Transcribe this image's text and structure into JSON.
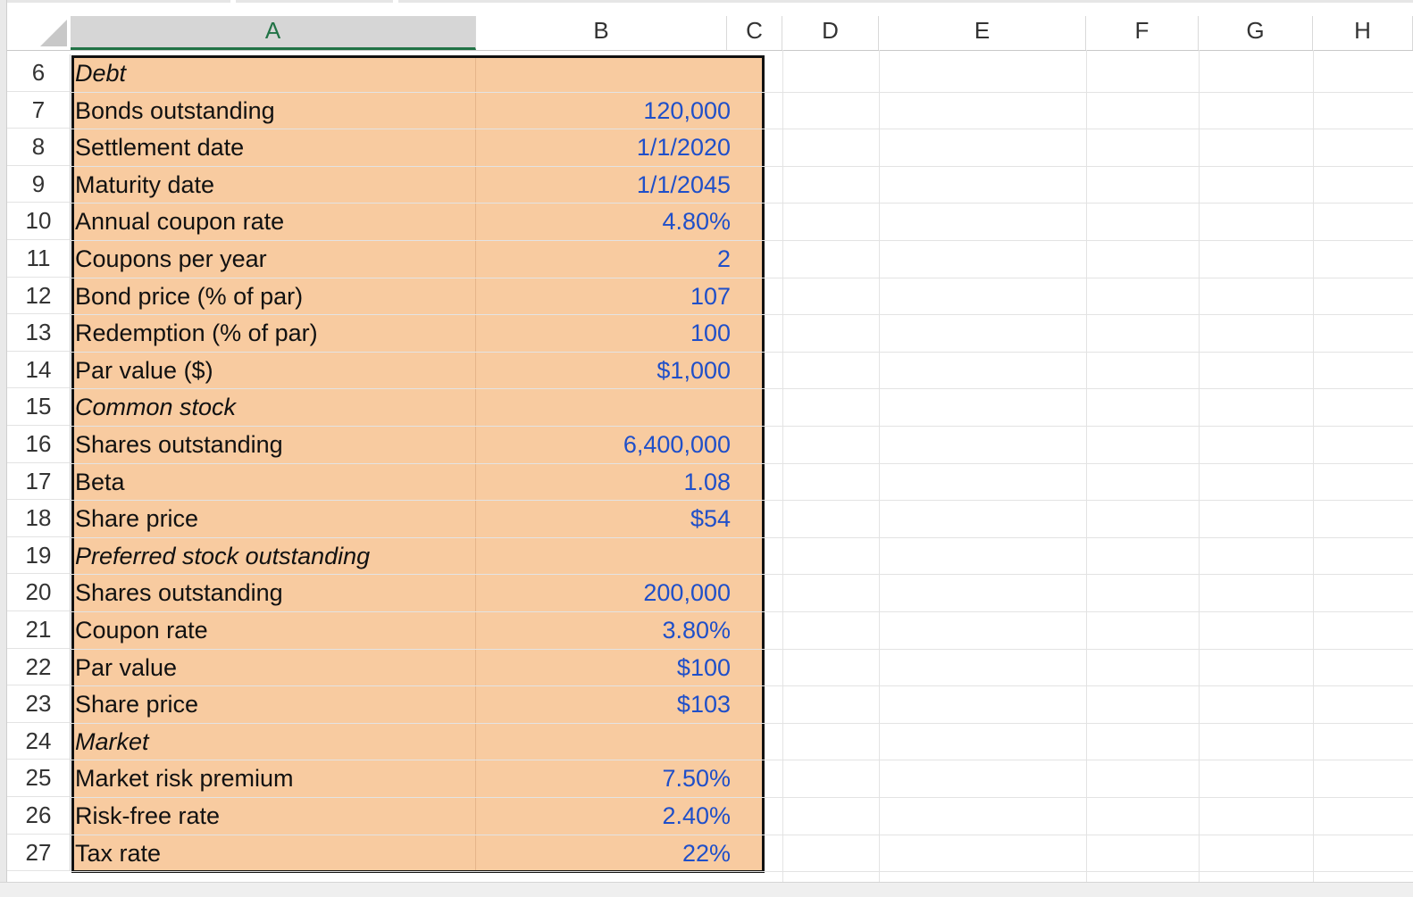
{
  "columns": [
    {
      "label": "A",
      "selected": true
    },
    {
      "label": "B",
      "selected": false
    },
    {
      "label": "C",
      "selected": false
    },
    {
      "label": "D",
      "selected": false
    },
    {
      "label": "E",
      "selected": false
    },
    {
      "label": "F",
      "selected": false
    },
    {
      "label": "G",
      "selected": false
    },
    {
      "label": "H",
      "selected": false
    }
  ],
  "rows": [
    {
      "num": "6",
      "label": "Debt",
      "value": "",
      "italic": true
    },
    {
      "num": "7",
      "label": "Bonds outstanding",
      "value": "120,000",
      "italic": false
    },
    {
      "num": "8",
      "label": "Settlement date",
      "value": "1/1/2020",
      "italic": false
    },
    {
      "num": "9",
      "label": "Maturity date",
      "value": "1/1/2045",
      "italic": false
    },
    {
      "num": "10",
      "label": "Annual coupon rate",
      "value": "4.80%",
      "italic": false
    },
    {
      "num": "11",
      "label": "Coupons per year",
      "value": "2",
      "italic": false
    },
    {
      "num": "12",
      "label": "Bond price (% of par)",
      "value": "107",
      "italic": false
    },
    {
      "num": "13",
      "label": "Redemption (% of par)",
      "value": "100",
      "italic": false
    },
    {
      "num": "14",
      "label": "Par value ($)",
      "value": "$1,000",
      "italic": false
    },
    {
      "num": "15",
      "label": "Common stock",
      "value": "",
      "italic": true
    },
    {
      "num": "16",
      "label": "Shares outstanding",
      "value": "6,400,000",
      "italic": false
    },
    {
      "num": "17",
      "label": "Beta",
      "value": "1.08",
      "italic": false
    },
    {
      "num": "18",
      "label": "Share price",
      "value": "$54",
      "italic": false
    },
    {
      "num": "19",
      "label": "Preferred stock outstanding",
      "value": "",
      "italic": true
    },
    {
      "num": "20",
      "label": "Shares outstanding",
      "value": "200,000",
      "italic": false
    },
    {
      "num": "21",
      "label": "Coupon rate",
      "value": "3.80%",
      "italic": false
    },
    {
      "num": "22",
      "label": "Par value",
      "value": "$100",
      "italic": false
    },
    {
      "num": "23",
      "label": "Share price",
      "value": "$103",
      "italic": false
    },
    {
      "num": "24",
      "label": "Market",
      "value": "",
      "italic": true
    },
    {
      "num": "25",
      "label": "Market risk premium",
      "value": "7.50%",
      "italic": false
    },
    {
      "num": "26",
      "label": "Risk-free rate",
      "value": "2.40%",
      "italic": false
    },
    {
      "num": "27",
      "label": "Tax rate",
      "value": "22%",
      "italic": false
    }
  ],
  "colors": {
    "input_fill": "#f8cba0",
    "value_text": "#1f4fc9",
    "selected_header": "#217346"
  }
}
